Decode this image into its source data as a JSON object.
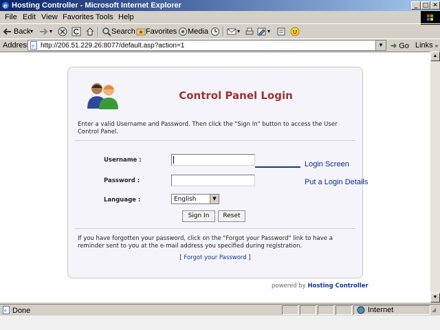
{
  "window": {
    "title": "Hosting Controller - Microsoft Internet Explorer",
    "controls": {
      "minimize": "_",
      "maximize": "□",
      "close": "✕"
    }
  },
  "menu": [
    "File",
    "Edit",
    "View",
    "Favorites",
    "Tools",
    "Help"
  ],
  "toolbar": {
    "back": "Back",
    "search": "Search",
    "favorites": "Favorites",
    "media": "Media"
  },
  "address": {
    "label": "Address",
    "url": "http://206.51.229.26:8077/default.asp?action=1",
    "go": "Go",
    "links": "Links"
  },
  "login": {
    "title": "Control Panel Login",
    "instructions": "Enter a valid Username and Password. Then click the \"Sign In\" button to access the User Control Panel.",
    "username_label": "Username :",
    "username_value": "",
    "password_label": "Password :",
    "password_value": "",
    "language_label": "Language :",
    "language_value": "English",
    "sign_in": "Sign In",
    "reset": "Reset",
    "forgot_text": "If you have forgotten your password, click on the \"Forgot your Password\" link to have a reminder sent to you at the e-mail address you specified during registration.",
    "forgot_open": "[",
    "forgot_link": "Forgot your Password",
    "forgot_close": "]",
    "powered_by": "powered by",
    "powered_brand": "Hosting Controller"
  },
  "annotations": {
    "screen": "Login Screen",
    "details": "Put a Login Details"
  },
  "status": {
    "text": "Done",
    "zone": "Internet"
  },
  "colors": {
    "title_red": "#993333",
    "link_blue": "#0b3a8a",
    "annotation_blue": "#0a2a80",
    "titlebar_dark": "#0a246a"
  }
}
